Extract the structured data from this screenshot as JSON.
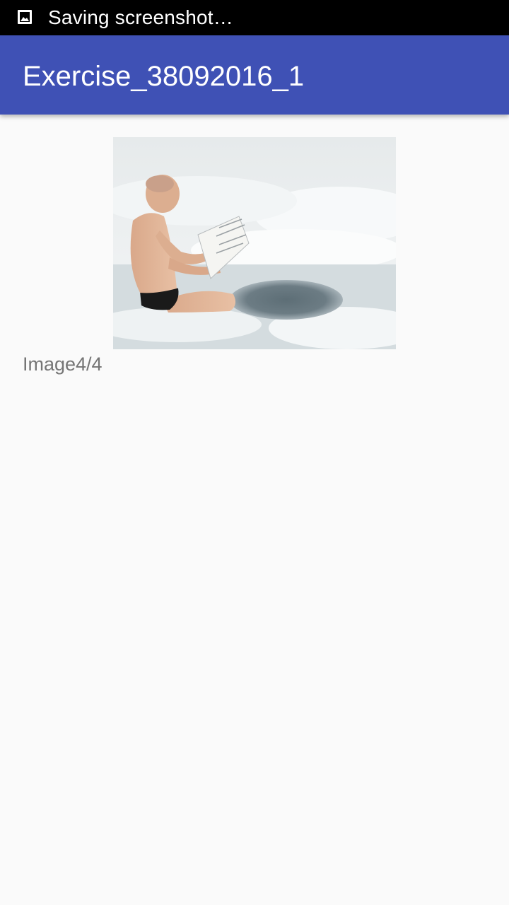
{
  "status_bar": {
    "notification_icon": "image-icon",
    "notification_text": "Saving screenshot…"
  },
  "app_bar": {
    "title": "Exercise_38092016_1",
    "color": "#3f51b5"
  },
  "content": {
    "image": {
      "subject": "photo"
    },
    "caption": "Image4/4"
  }
}
